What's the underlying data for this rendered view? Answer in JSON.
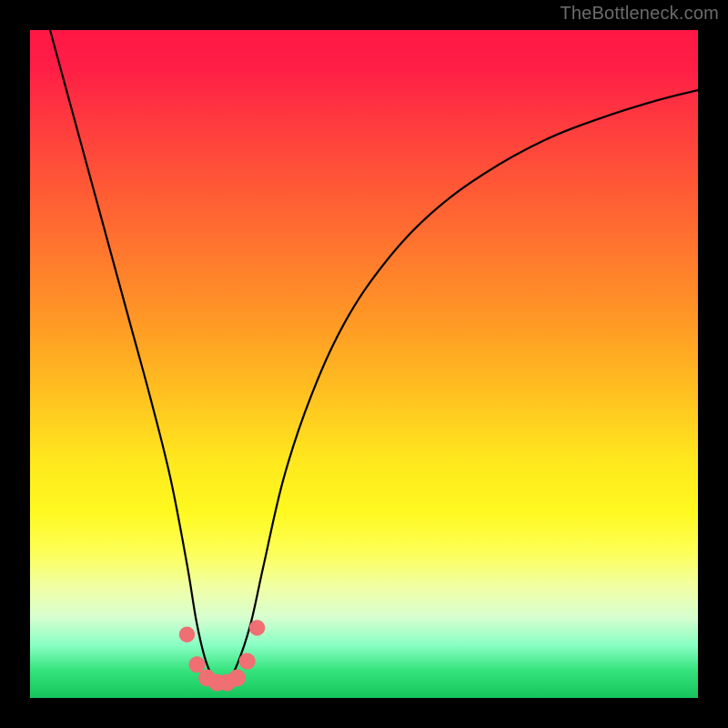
{
  "watermark": "TheBottleneck.com",
  "chart_data": {
    "type": "line",
    "title": "",
    "xlabel": "",
    "ylabel": "",
    "xlim": [
      0,
      100
    ],
    "ylim": [
      0,
      100
    ],
    "series": [
      {
        "name": "bottleneck-curve",
        "x": [
          3,
          6,
          9,
          12,
          15,
          18,
          21,
          23.5,
          25,
          26.5,
          28,
          29.5,
          31,
          33,
          35,
          38,
          42,
          47,
          53,
          60,
          68,
          77,
          86,
          94,
          100
        ],
        "y": [
          100,
          89,
          78,
          67,
          56,
          45,
          33,
          20,
          11,
          5,
          2.5,
          2.5,
          5,
          11,
          20,
          33,
          45,
          56,
          65,
          72.5,
          78.5,
          83.5,
          87,
          89.5,
          91
        ]
      }
    ],
    "markers": {
      "name": "valley-dots",
      "color": "#ef6f72",
      "points": [
        {
          "x": 23.5,
          "y": 9.5,
          "r": 1.0
        },
        {
          "x": 25.0,
          "y": 5.0,
          "r": 1.1
        },
        {
          "x": 26.5,
          "y": 3.0,
          "r": 1.2
        },
        {
          "x": 28.0,
          "y": 2.3,
          "r": 1.2
        },
        {
          "x": 29.5,
          "y": 2.3,
          "r": 1.2
        },
        {
          "x": 31.0,
          "y": 3.0,
          "r": 1.2
        },
        {
          "x": 32.5,
          "y": 5.5,
          "r": 1.1
        },
        {
          "x": 34.0,
          "y": 10.5,
          "r": 1.0
        }
      ]
    },
    "gradient_stops": [
      {
        "pos": 0,
        "color": "#ff1745"
      },
      {
        "pos": 0.5,
        "color": "#ffbf20"
      },
      {
        "pos": 0.78,
        "color": "#fdff55"
      },
      {
        "pos": 1.0,
        "color": "#17c45c"
      }
    ]
  }
}
